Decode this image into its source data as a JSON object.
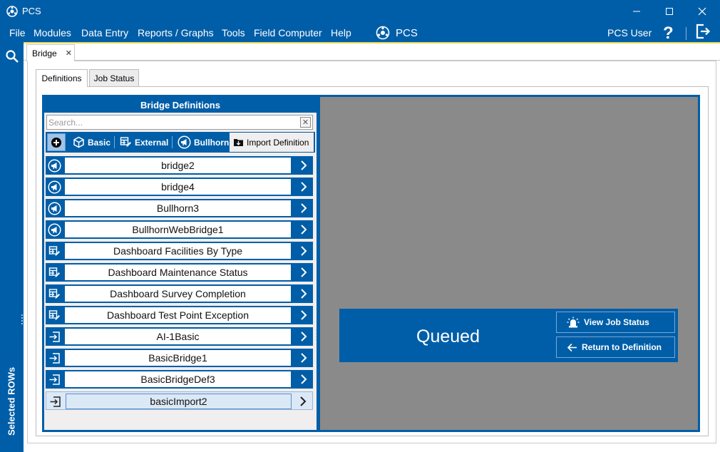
{
  "window": {
    "title": "PCS",
    "controls": [
      "minimize",
      "maximize",
      "close"
    ]
  },
  "menu": {
    "items": [
      "File",
      "Modules",
      "Data Entry",
      "Reports / Graphs",
      "Tools",
      "Field Computer",
      "Help"
    ],
    "logo_label": "PCS",
    "user": "PCS User",
    "help_symbol": "?"
  },
  "left_rail": {
    "label": "Selected ROWs"
  },
  "document_tabs": [
    {
      "label": "Bridge",
      "close": "✕",
      "active": true
    }
  ],
  "sub_tabs": [
    {
      "label": "Definitions",
      "active": true
    },
    {
      "label": "Job Status",
      "active": false
    }
  ],
  "bridge_panel": {
    "title": "Bridge Definitions",
    "search_placeholder": "Search...",
    "clear_symbol": "✕",
    "toolbar": {
      "basic": "Basic",
      "external": "External",
      "bullhorn": "Bullhorn",
      "import": "Import Definition"
    },
    "definitions": [
      {
        "name": "bridge2",
        "icon": "bullhorn-icon"
      },
      {
        "name": "bridge4",
        "icon": "bullhorn-icon"
      },
      {
        "name": "Bullhorn3",
        "icon": "bullhorn-icon"
      },
      {
        "name": "BullhornWebBridge1",
        "icon": "bullhorn-icon"
      },
      {
        "name": "Dashboard Facilities By Type",
        "icon": "external-icon"
      },
      {
        "name": "Dashboard Maintenance Status",
        "icon": "external-icon"
      },
      {
        "name": "Dashboard Survey Completion",
        "icon": "external-icon"
      },
      {
        "name": "Dashboard Test Point Exception",
        "icon": "external-icon"
      },
      {
        "name": "AI-1Basic",
        "icon": "basic-import-icon"
      },
      {
        "name": "BasicBridge1",
        "icon": "basic-import-icon"
      },
      {
        "name": "BasicBridgeDef3",
        "icon": "basic-import-icon"
      },
      {
        "name": "basicImport2",
        "icon": "basic-import-icon",
        "selected": true
      }
    ]
  },
  "job_status": {
    "status": "Queued",
    "view_button": "View Job Status",
    "return_button": "Return to Definition"
  },
  "colors": {
    "brand_blue": "#005ea8",
    "accent_yellow": "#e6d95a",
    "status_panel_gray": "#8a8a8a"
  }
}
